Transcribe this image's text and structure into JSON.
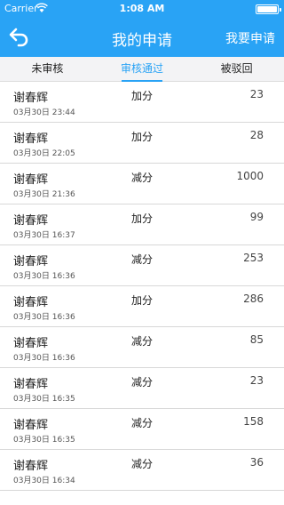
{
  "status_bar": {
    "carrier": "Carrier",
    "time": "1:08 AM",
    "battery_level": 1.0
  },
  "nav": {
    "title": "我的申请",
    "right_button": "我要申请",
    "back_icon": "back-arrow-icon"
  },
  "tabs": [
    {
      "label": "未审核",
      "active": false
    },
    {
      "label": "审核通过",
      "active": true
    },
    {
      "label": "被驳回",
      "active": false
    }
  ],
  "records": [
    {
      "name": "谢春辉",
      "type": "加分",
      "amount": "23",
      "date": "03月30日 23:44"
    },
    {
      "name": "谢春辉",
      "type": "加分",
      "amount": "28",
      "date": "03月30日 22:05"
    },
    {
      "name": "谢春辉",
      "type": "减分",
      "amount": "1000",
      "date": "03月30日 21:36"
    },
    {
      "name": "谢春辉",
      "type": "加分",
      "amount": "99",
      "date": "03月30日 16:37"
    },
    {
      "name": "谢春辉",
      "type": "减分",
      "amount": "253",
      "date": "03月30日 16:36"
    },
    {
      "name": "谢春辉",
      "type": "加分",
      "amount": "286",
      "date": "03月30日 16:36"
    },
    {
      "name": "谢春辉",
      "type": "减分",
      "amount": "85",
      "date": "03月30日 16:36"
    },
    {
      "name": "谢春辉",
      "type": "减分",
      "amount": "23",
      "date": "03月30日 16:35"
    },
    {
      "name": "谢春辉",
      "type": "减分",
      "amount": "158",
      "date": "03月30日 16:35"
    },
    {
      "name": "谢春辉",
      "type": "减分",
      "amount": "36",
      "date": "03月30日 16:34"
    }
  ],
  "colors": {
    "accent": "#29a3f5"
  }
}
